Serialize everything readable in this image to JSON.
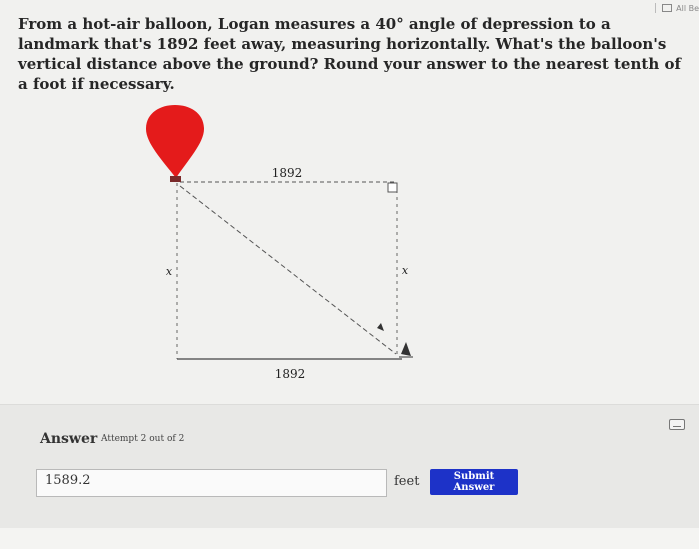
{
  "topbar": {
    "label": "All Be"
  },
  "question": {
    "text": "From a hot-air balloon, Logan measures a 40° angle of depression to a landmark that's 1892 feet away, measuring horizontally. What's the balloon's vertical distance above the ground? Round your answer to the nearest tenth of a foot if necessary."
  },
  "diagram": {
    "top_label": "1892",
    "bottom_label": "1892",
    "left_label": "x",
    "right_label": "x"
  },
  "answer": {
    "label": "Answer",
    "attempt": "Attempt 2 out of 2",
    "input_value": "1589.2",
    "unit": "feet",
    "submit_label": "Submit Answer"
  }
}
